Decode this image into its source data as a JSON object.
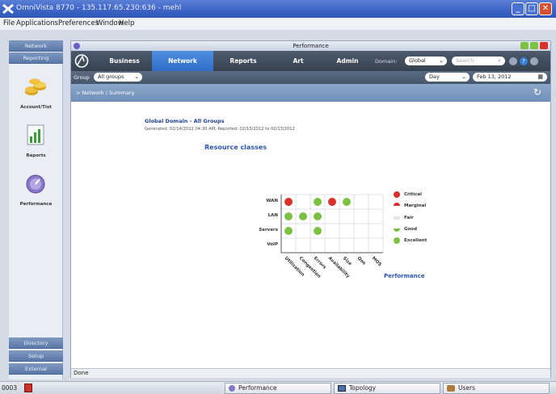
{
  "window": {
    "title": "OmniVista 8770 - 135.117.65.230:636 - mehl"
  },
  "menubar": [
    "File",
    "Applications",
    "Preferences",
    "Window",
    "Help"
  ],
  "left_nav": {
    "top_buttons": [
      "Network",
      "Reporting"
    ],
    "items": [
      "Account/Tixt",
      "Reports",
      "Performance"
    ],
    "bottom_buttons": [
      "Directory",
      "Setup",
      "External"
    ]
  },
  "panel": {
    "title": "Performance",
    "tabs": [
      "Business",
      "Network",
      "Reports",
      "Art",
      "Admin"
    ],
    "active_tab": "Network",
    "domain_label": "Domain:",
    "domain_value": "Global",
    "search_placeholder": "Search",
    "group_label": "Group",
    "group_value": "All groups",
    "period_value": "Day",
    "date_value": "Feb 13, 2012",
    "breadcrumb": "> Network / Summary",
    "status": "Done"
  },
  "report": {
    "heading": "Global Domain - All Groups",
    "generated": "Generated: 02/14/2012 04:30 AM; Reported: 02/13/2012 to 02/13/2012",
    "title": "Resource classes",
    "rows": [
      "WAN",
      "LAN",
      "Servers",
      "VoIP"
    ],
    "columns": [
      "Utilization",
      "Congestion",
      "Errors",
      "Availability",
      "Size",
      "Qos",
      "MOS"
    ],
    "column_group_label": "Performance",
    "legend": [
      "Critical",
      "Marginal",
      "Fair",
      "Good",
      "Excellent"
    ],
    "colors": {
      "critical": "#d9302a",
      "good": "#7cc142",
      "fair": "#e6e6e6"
    },
    "matrix": [
      [
        "critical",
        "",
        "good",
        "critical",
        "good",
        "",
        ""
      ],
      [
        "good",
        "good",
        "good",
        "",
        "",
        "",
        ""
      ],
      [
        "good",
        "",
        "good",
        "",
        "",
        "",
        ""
      ],
      [
        "",
        "",
        "",
        "",
        "",
        "",
        ""
      ]
    ]
  },
  "taskbar": {
    "counter": "0003",
    "buttons": [
      "Performance",
      "Topology",
      "Users"
    ]
  }
}
